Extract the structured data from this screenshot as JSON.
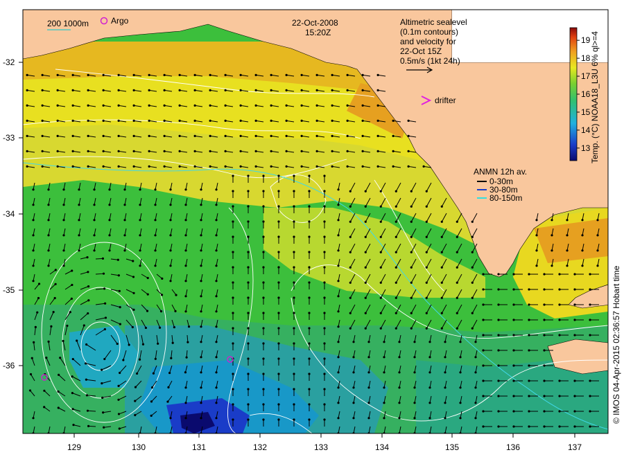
{
  "date": "22-Oct-2008",
  "time": "15:20Z",
  "altimetry_lines": [
    "Altimetric sealevel",
    "(0.1m contours)",
    "and velocity for",
    "22-Oct 15Z",
    "0.5m/s (1kt 24h)"
  ],
  "scale_label": "200  1000m",
  "argo_label": "Argo",
  "drifter_label": "drifter",
  "anmn": {
    "title": "ANMN 12h av.",
    "items": [
      {
        "label": "0-30m",
        "color": "#000000"
      },
      {
        "label": "30-80m",
        "color": "#1a3cc8"
      },
      {
        "label": "80-150m",
        "color": "#30e0e0"
      }
    ]
  },
  "colorbar": {
    "ticks": [
      "13",
      "14",
      "15",
      "16",
      "17",
      "18",
      "19"
    ],
    "title": "Temp. (°C) NOAA18_L3U 6% ql>=4",
    "range": [
      12.3,
      19.7
    ]
  },
  "axes": {
    "lon_ticks": [
      "129",
      "130",
      "131",
      "132",
      "133",
      "134",
      "135",
      "136",
      "137"
    ],
    "lat_ticks": [
      "-32",
      "-33",
      "-34",
      "-35",
      "-36"
    ]
  },
  "credit": "© IMOS 04-Apr-2015 02:36:57 Hobart time",
  "colors": {
    "land": "#f9c79d",
    "warm": "#e6b820",
    "yellow": "#e8e820",
    "green": "#3cbf3c",
    "cyan": "#16a8c8",
    "blue": "#1830a0",
    "argo": "#d020d0",
    "contour": "#ffffff"
  }
}
